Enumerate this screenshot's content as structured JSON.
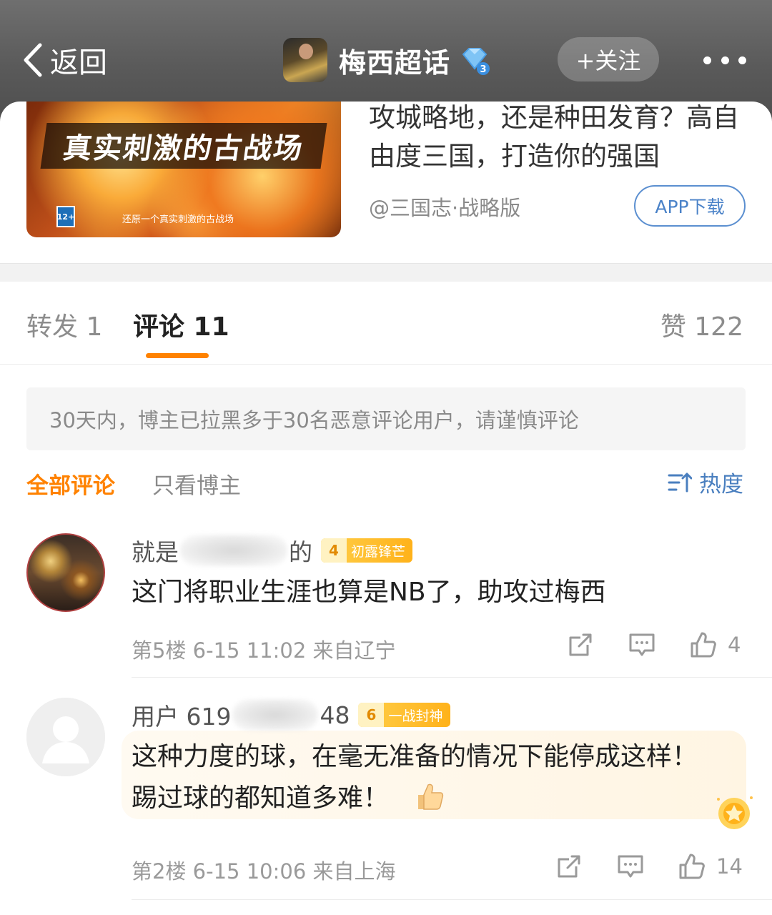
{
  "nav": {
    "back_label": "返回",
    "title": "梅西超话",
    "follow_label": "+关注"
  },
  "ad": {
    "image_title": "真实刺激的古战场",
    "image_subtitle": "还原一个真实刺激的古战场",
    "age_rating": "12+",
    "text": "攻城略地，还是种田发育？高自由度三国，打造你的强国",
    "source": "@三国志·战略版",
    "cta_label": "APP下载"
  },
  "tabs": {
    "repost": "转发 1",
    "comment": "评论 11",
    "like": "赞 122"
  },
  "notice": "30天内，博主已拉黑多于30名恶意评论用户，请谨慎评论",
  "filter": {
    "all": "全部评论",
    "blogger_only": "只看博主",
    "sort": "热度"
  },
  "comments": [
    {
      "name_prefix": "就是",
      "name_suffix": "的",
      "badge_level": "4",
      "badge_text": "初露锋芒",
      "text": "这门将职业生涯也算是NB了，助攻过梅西",
      "meta": "第5楼  6-15 11:02  来自辽宁",
      "likes": "4"
    },
    {
      "name_prefix": "用户 619",
      "name_suffix": "48",
      "badge_level": "6",
      "badge_text": "一战封神",
      "text": "这种力度的球，在毫无准备的情况下能停成这样！踢过球的都知道多难！",
      "meta": "第2楼  6-15 10:06  来自上海",
      "likes": "14"
    }
  ],
  "icons": {
    "back": "chevron-left-icon",
    "diamond": "diamond-level-icon",
    "more": "more-dots-icon",
    "sort": "sort-icon",
    "repost": "share-icon",
    "reply": "comment-icon",
    "like": "thumbs-up-icon"
  },
  "colors": {
    "accent": "#ff8200",
    "link_blue": "#4a7fbf",
    "badge_gold": "#ffb21a"
  }
}
